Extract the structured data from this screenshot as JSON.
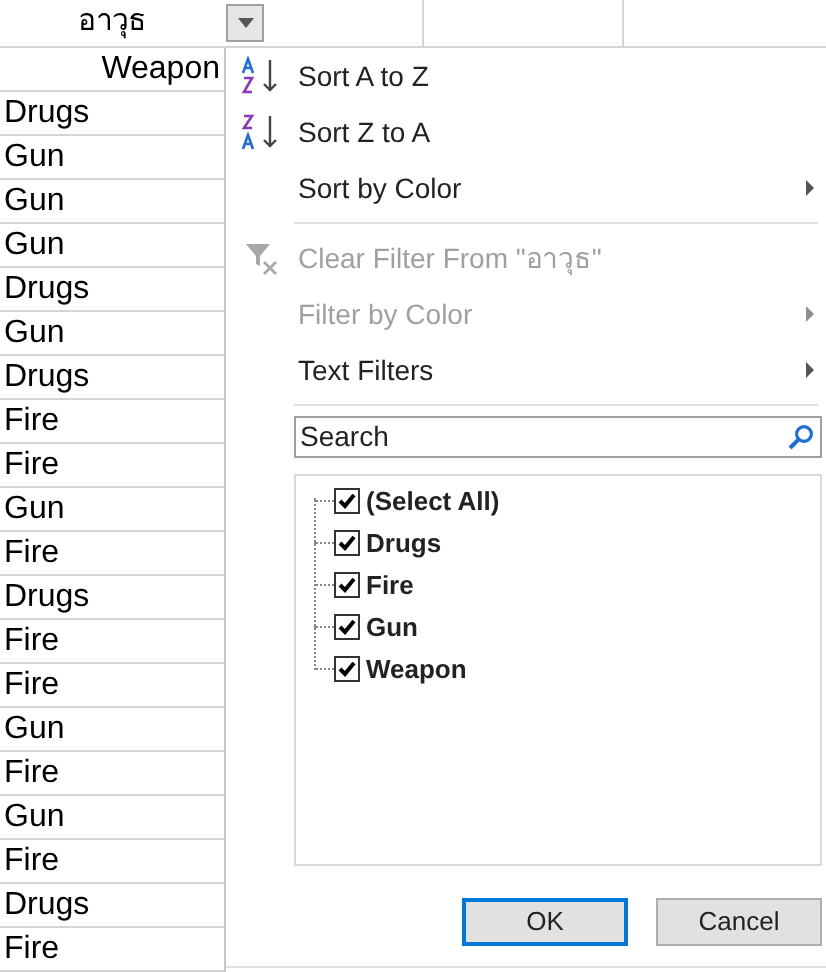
{
  "column_header": {
    "title": "อาวุธ"
  },
  "cells": [
    "Weapon",
    "Drugs",
    "Gun",
    "Gun",
    "Gun",
    "Drugs",
    "Gun",
    "Drugs",
    "Fire",
    "Fire",
    "Gun",
    "Fire",
    "Drugs",
    "Fire",
    "Fire",
    "Gun",
    "Fire",
    "Gun",
    "Fire",
    "Drugs",
    "Fire"
  ],
  "menu": {
    "items": [
      {
        "kind": "sort_asc",
        "label": "Sort A to Z",
        "disabled": false,
        "submenu": false
      },
      {
        "kind": "sort_desc",
        "label": "Sort Z to A",
        "disabled": false,
        "submenu": false
      },
      {
        "kind": "plain",
        "label": "Sort by Color",
        "disabled": false,
        "submenu": true
      },
      {
        "kind": "separator"
      },
      {
        "kind": "clear_filter",
        "label": "Clear Filter From \"อาวุธ\"",
        "disabled": true,
        "submenu": false
      },
      {
        "kind": "plain",
        "label": "Filter by Color",
        "disabled": true,
        "submenu": true
      },
      {
        "kind": "plain",
        "label": "Text Filters",
        "disabled": false,
        "submenu": true
      },
      {
        "kind": "separator"
      }
    ],
    "search": {
      "placeholder": "Search"
    },
    "values": [
      {
        "label": "(Select All)",
        "checked": true
      },
      {
        "label": "Drugs",
        "checked": true
      },
      {
        "label": "Fire",
        "checked": true
      },
      {
        "label": "Gun",
        "checked": true
      },
      {
        "label": "Weapon",
        "checked": true
      }
    ],
    "buttons": [
      {
        "label": "OK",
        "default": true
      },
      {
        "label": "Cancel",
        "default": false
      }
    ]
  }
}
